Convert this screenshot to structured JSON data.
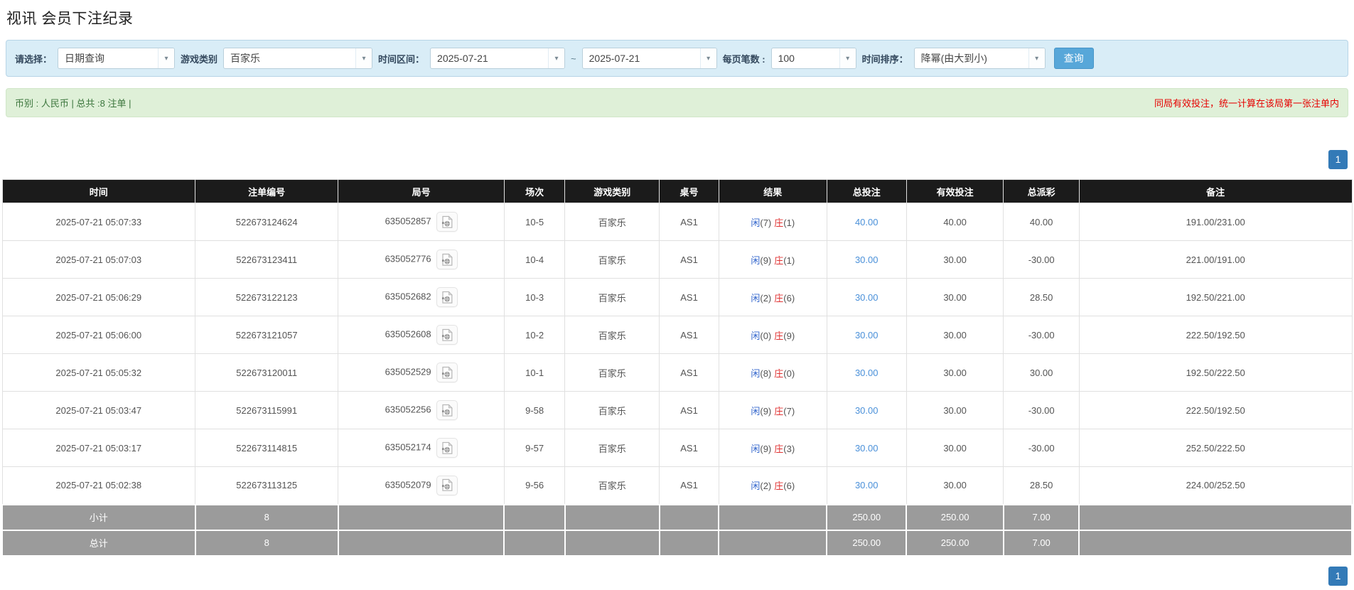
{
  "page": {
    "title": "视讯 会员下注纪录"
  },
  "filters": {
    "select_label": "请选择：",
    "select_value": "日期查询",
    "game_type_label": "游戏类别",
    "game_type_value": "百家乐",
    "time_range_label": "时间区间：",
    "time_from": "2025-07-21",
    "time_separator": "~",
    "time_to": "2025-07-21",
    "page_size_label": "每页笔数 :",
    "page_size_value": "100",
    "sort_label": "时间排序：",
    "sort_value": "降幂(由大到小)",
    "search_button": "查询"
  },
  "summary_bar": {
    "left_text": "币别 : 人民币 | 总共 :8 注单 |",
    "right_note": "同局有效投注，统一计算在该局第一张注单内"
  },
  "pagination": {
    "current_page": "1"
  },
  "icons": {
    "combo_arrow_glyph": "▾",
    "video_button_meaning": "video-replay-icon"
  },
  "colors": {
    "accent_blue": "#337ab7",
    "search_button_blue": "#57a7d9",
    "link_blue": "#4a90d9",
    "player_blue": "#3366cc",
    "banker_red": "#e03333",
    "negative_red": "#e8332a",
    "note_red": "#e60000",
    "summary_green": "#3c763d",
    "header_bg": "#1b1b1b",
    "filter_bg": "#d9edf7",
    "summary_bg": "#dff0d8",
    "subtotal_bg": "#9b9b9b"
  },
  "table": {
    "headers": [
      "时间",
      "注单编号",
      "局号",
      "场次",
      "游戏类别",
      "桌号",
      "结果",
      "总投注",
      "有效投注",
      "总派彩",
      "备注"
    ],
    "rows": [
      {
        "time": "2025-07-21 05:07:33",
        "bet_id": "522673124624",
        "round_id": "635052857",
        "session": "10-5",
        "game": "百家乐",
        "table_no": "AS1",
        "result_player_label": "闲",
        "result_player_value": "(7)",
        "result_banker_label": "庄",
        "result_banker_value": "(1)",
        "total_bet": "40.00",
        "valid_bet": "40.00",
        "payout": "40.00",
        "remark": "191.00/231.00"
      },
      {
        "time": "2025-07-21 05:07:03",
        "bet_id": "522673123411",
        "round_id": "635052776",
        "session": "10-4",
        "game": "百家乐",
        "table_no": "AS1",
        "result_player_label": "闲",
        "result_player_value": "(9)",
        "result_banker_label": "庄",
        "result_banker_value": "(1)",
        "total_bet": "30.00",
        "valid_bet": "30.00",
        "payout": "-30.00",
        "remark": "221.00/191.00"
      },
      {
        "time": "2025-07-21 05:06:29",
        "bet_id": "522673122123",
        "round_id": "635052682",
        "session": "10-3",
        "game": "百家乐",
        "table_no": "AS1",
        "result_player_label": "闲",
        "result_player_value": "(2)",
        "result_banker_label": "庄",
        "result_banker_value": "(6)",
        "total_bet": "30.00",
        "valid_bet": "30.00",
        "payout": "28.50",
        "remark": "192.50/221.00"
      },
      {
        "time": "2025-07-21 05:06:00",
        "bet_id": "522673121057",
        "round_id": "635052608",
        "session": "10-2",
        "game": "百家乐",
        "table_no": "AS1",
        "result_player_label": "闲",
        "result_player_value": "(0)",
        "result_banker_label": "庄",
        "result_banker_value": "(9)",
        "total_bet": "30.00",
        "valid_bet": "30.00",
        "payout": "-30.00",
        "remark": "222.50/192.50"
      },
      {
        "time": "2025-07-21 05:05:32",
        "bet_id": "522673120011",
        "round_id": "635052529",
        "session": "10-1",
        "game": "百家乐",
        "table_no": "AS1",
        "result_player_label": "闲",
        "result_player_value": "(8)",
        "result_banker_label": "庄",
        "result_banker_value": "(0)",
        "total_bet": "30.00",
        "valid_bet": "30.00",
        "payout": "30.00",
        "remark": "192.50/222.50"
      },
      {
        "time": "2025-07-21 05:03:47",
        "bet_id": "522673115991",
        "round_id": "635052256",
        "session": "9-58",
        "game": "百家乐",
        "table_no": "AS1",
        "result_player_label": "闲",
        "result_player_value": "(9)",
        "result_banker_label": "庄",
        "result_banker_value": "(7)",
        "total_bet": "30.00",
        "valid_bet": "30.00",
        "payout": "-30.00",
        "remark": "222.50/192.50"
      },
      {
        "time": "2025-07-21 05:03:17",
        "bet_id": "522673114815",
        "round_id": "635052174",
        "session": "9-57",
        "game": "百家乐",
        "table_no": "AS1",
        "result_player_label": "闲",
        "result_player_value": "(9)",
        "result_banker_label": "庄",
        "result_banker_value": "(3)",
        "total_bet": "30.00",
        "valid_bet": "30.00",
        "payout": "-30.00",
        "remark": "252.50/222.50"
      },
      {
        "time": "2025-07-21 05:02:38",
        "bet_id": "522673113125",
        "round_id": "635052079",
        "session": "9-56",
        "game": "百家乐",
        "table_no": "AS1",
        "result_player_label": "闲",
        "result_player_value": "(2)",
        "result_banker_label": "庄",
        "result_banker_value": "(6)",
        "total_bet": "30.00",
        "valid_bet": "30.00",
        "payout": "28.50",
        "remark": "224.00/252.50"
      }
    ],
    "subtotal": {
      "label": "小计",
      "count": "8",
      "total_bet": "250.00",
      "valid_bet": "250.00",
      "payout": "7.00"
    },
    "total": {
      "label": "总计",
      "count": "8",
      "total_bet": "250.00",
      "valid_bet": "250.00",
      "payout": "7.00"
    }
  }
}
